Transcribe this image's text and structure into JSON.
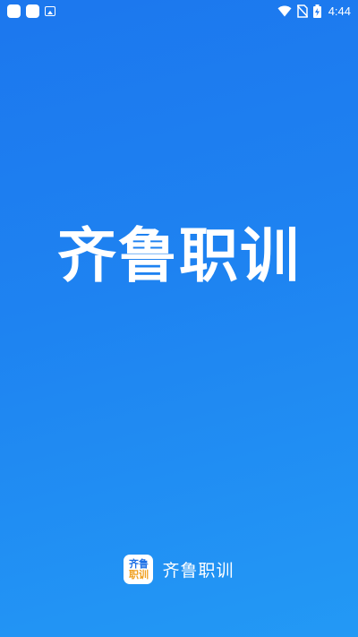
{
  "status_bar": {
    "time": "4:44",
    "left_icons": [
      "notification-app-icon",
      "notification-app-icon",
      "image-icon"
    ],
    "right_icons": [
      "wifi-icon",
      "no-sim-icon",
      "battery-charging-icon"
    ]
  },
  "splash": {
    "title": "齐鲁职训"
  },
  "footer": {
    "logo_line1": "齐鲁",
    "logo_line2": "职训",
    "app_name": "齐鲁职训"
  },
  "colors": {
    "background_top": "#1c77ee",
    "background_bottom": "#2399f5",
    "logo_blue": "#1c6fe6",
    "logo_orange": "#f0a020"
  }
}
